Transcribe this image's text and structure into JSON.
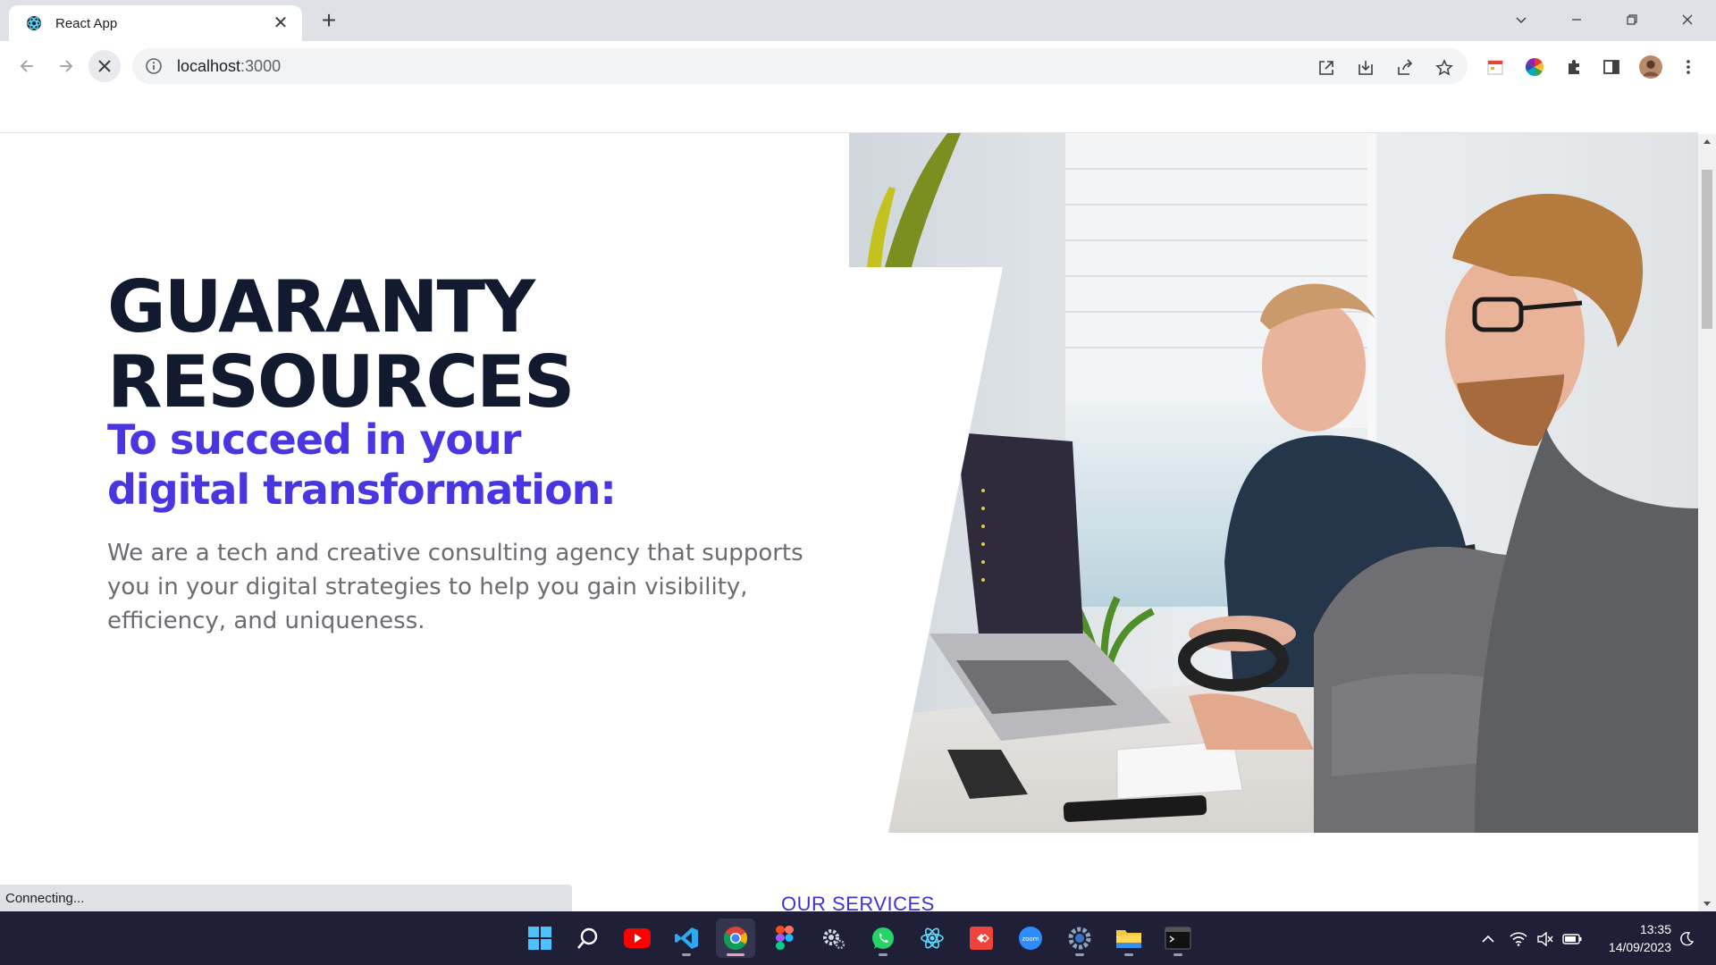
{
  "browser": {
    "tab": {
      "title": "React App",
      "close_glyph": "✕"
    },
    "new_tab_glyph": "+",
    "address": {
      "host": "localhost",
      "port": ":3000"
    },
    "status_text": "Connecting..."
  },
  "hero": {
    "title_line1": "GUARANTY",
    "title_line2": "RESOURCES",
    "subtitle_line1": "To succeed in your",
    "subtitle_line2": "digital transformation:",
    "description": "We are a tech and creative consulting agency that supports you in your digital strategies to help you gain visibility, efficiency, and uniqueness.",
    "photo_icon": "office-workers-photo"
  },
  "services": {
    "heading": "OUR SERVICES"
  },
  "taskbar": {
    "apps": [
      "start",
      "search",
      "youtube",
      "vscode",
      "chrome",
      "figma",
      "settings-gear",
      "whatsapp",
      "react",
      "anydesk",
      "zoom",
      "settings",
      "file-explorer",
      "terminal"
    ],
    "clock": {
      "time": "13:35",
      "date": "14/09/2023"
    }
  },
  "colors": {
    "title": "#111a2e",
    "accent": "#4a36e0",
    "services": "#3d32d3",
    "taskbar": "#1f2038"
  }
}
